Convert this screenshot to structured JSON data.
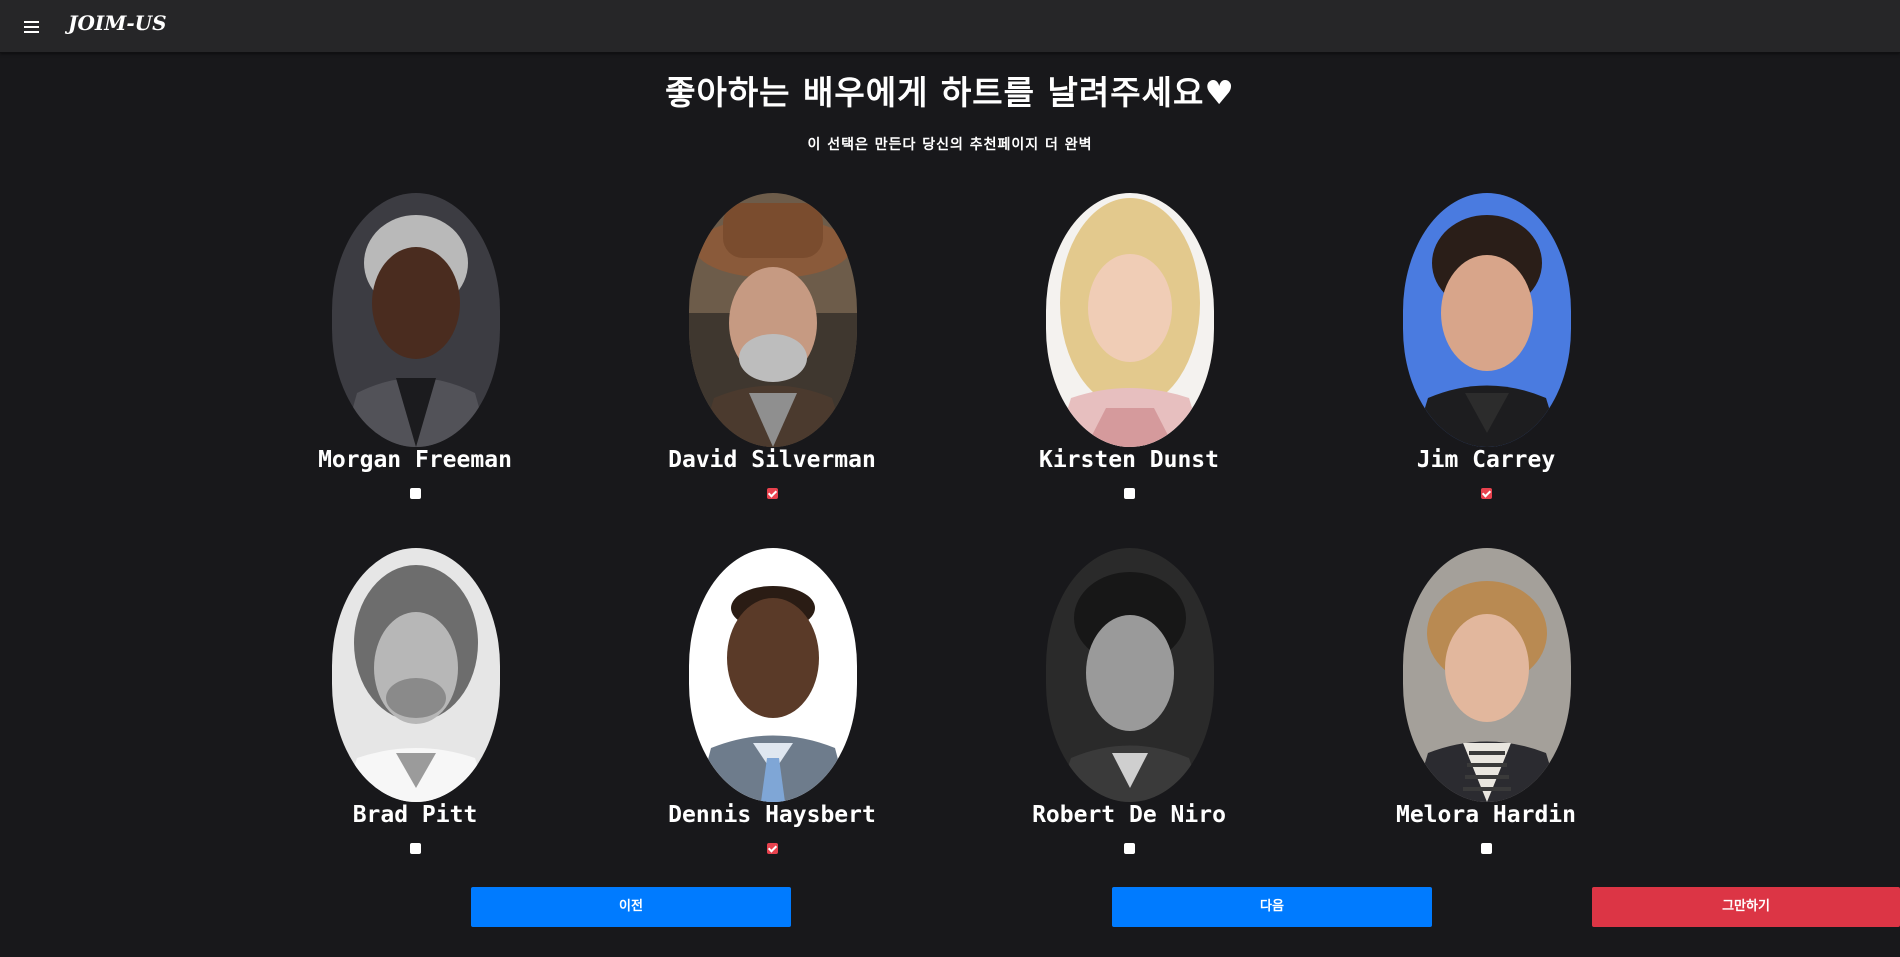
{
  "header": {
    "brand": "JOIM-US",
    "menu_icon": "hamburger-menu-icon"
  },
  "main": {
    "title": "좋아하는 배우에게 하트를 날려주세요♥",
    "subtitle": "이 선택은 만든다 당신의 추천페이지 더 완벽"
  },
  "actors": [
    {
      "name": "Morgan Freeman",
      "liked": false
    },
    {
      "name": "David Silverman",
      "liked": true
    },
    {
      "name": "Kirsten Dunst",
      "liked": false
    },
    {
      "name": "Jim Carrey",
      "liked": true
    },
    {
      "name": "Brad Pitt",
      "liked": false
    },
    {
      "name": "Dennis Haysbert",
      "liked": true
    },
    {
      "name": "Robert De Niro",
      "liked": false
    },
    {
      "name": "Melora Hardin",
      "liked": false
    }
  ],
  "buttons": {
    "prev": "이전",
    "next": "다음",
    "quit": "그만하기"
  },
  "colors": {
    "background": "#18181b",
    "navbar": "#262628",
    "primary": "#007bff",
    "danger": "#dc3545",
    "checked": "#e8424e"
  }
}
